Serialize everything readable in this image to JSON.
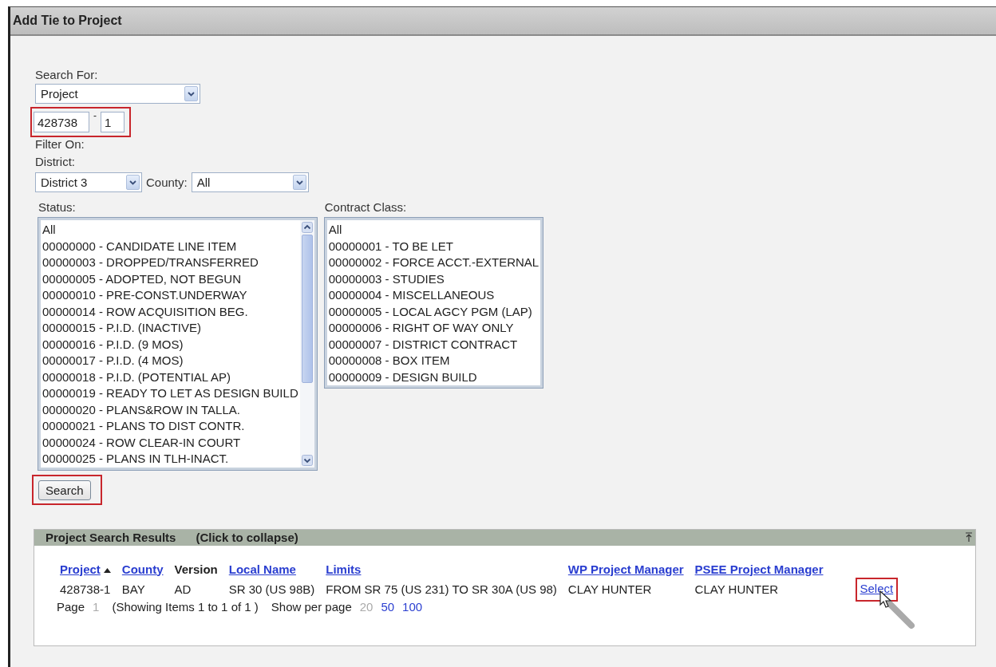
{
  "window": {
    "title": "Add Tie to Project"
  },
  "search_for": {
    "label": "Search For:",
    "value": "Project"
  },
  "project_number": {
    "value": "428738",
    "separator": "-",
    "version": "1",
    "highlighted": true
  },
  "filter_on": {
    "label": "Filter On:"
  },
  "district": {
    "label": "District:",
    "value": "District 3"
  },
  "county": {
    "label": "County:",
    "value": "All"
  },
  "status": {
    "label": "Status:",
    "items": [
      "All",
      "00000000 - CANDIDATE LINE ITEM",
      "00000003 - DROPPED/TRANSFERRED",
      "00000005 - ADOPTED, NOT BEGUN",
      "00000010 - PRE-CONST.UNDERWAY",
      "00000014 - ROW ACQUISITION BEG.",
      "00000015 - P.I.D. (INACTIVE)",
      "00000016 - P.I.D. (9 MOS)",
      "00000017 - P.I.D. (4 MOS)",
      "00000018 - P.I.D. (POTENTIAL AP)",
      "00000019 - READY TO LET AS DESIGN BUILD",
      "00000020 - PLANS&ROW IN TALLA.",
      "00000021 - PLANS TO DIST CONTR.",
      "00000024 - ROW CLEAR-IN COURT",
      "00000025 - PLANS IN TLH-INACT."
    ]
  },
  "contract_class": {
    "label": "Contract Class:",
    "items": [
      "All",
      "00000001 - TO BE LET",
      "00000002 - FORCE ACCT.-EXTERNAL",
      "00000003 - STUDIES",
      "00000004 - MISCELLANEOUS",
      "00000005 - LOCAL AGCY PGM (LAP)",
      "00000006 - RIGHT OF WAY ONLY",
      "00000007 - DISTRICT CONTRACT",
      "00000008 - BOX ITEM",
      "00000009 - DESIGN BUILD"
    ]
  },
  "search_button": {
    "label": "Search",
    "highlighted": true
  },
  "results": {
    "title": "Project Search Results",
    "collapse_hint": "(Click to collapse)",
    "columns": [
      {
        "label": "Project",
        "link": true,
        "sorted": true
      },
      {
        "label": "County",
        "link": true,
        "sorted": false
      },
      {
        "label": "Version",
        "link": false,
        "sorted": false
      },
      {
        "label": "Local Name",
        "link": true,
        "sorted": false
      },
      {
        "label": "Limits",
        "link": true,
        "sorted": false
      },
      {
        "label": "WP Project Manager",
        "link": true,
        "sorted": false
      },
      {
        "label": "PSEE Project Manager",
        "link": true,
        "sorted": false
      }
    ],
    "rows": [
      {
        "cells": [
          "428738-1",
          "BAY",
          "AD",
          "SR 30 (US 98B)",
          "FROM SR 75 (US 231) TO SR 30A (US 98)",
          "CLAY HUNTER",
          "CLAY HUNTER"
        ],
        "action": "Select",
        "highlighted": true
      }
    ],
    "paging": {
      "page_label": "Page",
      "page": "1",
      "showing": "(Showing Items 1 to 1 of 1 )",
      "per_page_label": "Show per page",
      "per_page": [
        {
          "label": "20",
          "selected": true
        },
        {
          "label": "50",
          "selected": false
        },
        {
          "label": "100",
          "selected": false
        }
      ]
    }
  }
}
